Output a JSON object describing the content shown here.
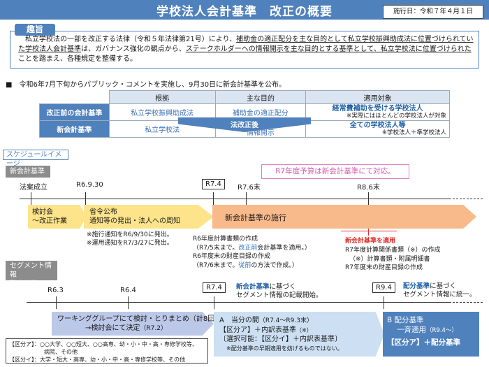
{
  "header": {
    "title": "学校法人会計基準　改正の概要",
    "effective_date": "施行日：令和７年４月１日"
  },
  "summary": {
    "label": "趣旨",
    "text_1": "　私立学校法の一部を改正する法律（令和５年法律第21号）により、",
    "text_2": "補助金の適正配分を主な目的として私立学校振興助成法に位置づけられていた学校法人会計基準",
    "text_3": "は、ガバナンス強化の観点から、",
    "text_4": "ステークホルダーへの情報開示を主な目的とする基準として、私立学校法に位置づけられた",
    "text_5": "ことを踏まえ、各種規定を整備する。"
  },
  "announcement": "■　令和6年7月下旬からパブリック・コメントを実施し、9月30日に新会計基準を公布。",
  "comparison_table": {
    "headers": [
      "根拠",
      "主な目的",
      "適用対象"
    ],
    "rows": [
      {
        "label": "改正前の会計基準",
        "basis": "私立学校振興助成法",
        "purpose": "補助金の適正配分",
        "target": "経常費補助を受ける学校法人",
        "target_note": "※実際にはほとんどの学校法人が対象"
      },
      {
        "label": "新会計基準",
        "basis": "私立学校法",
        "purpose": "情報開示",
        "target": "全ての学校法人等",
        "target_note": "※学校法人＋準学校法人"
      }
    ],
    "arrow_label": "法改正後"
  },
  "schedule": {
    "tag": "スケジュールイメージ",
    "new_standard": {
      "label": "新会計基準",
      "budget_note": "R7年度予算は新会計基準にて対応。",
      "points": {
        "bill": "法案成立",
        "r6_9_30": "R6.9.30",
        "r7_4": "R7.4",
        "r7_6": "R7.6末",
        "r8_6": "R8.6末"
      },
      "review_1": "検討会",
      "review_2": "～改正作業",
      "ordinance_1": "省令公布",
      "ordinance_2": "通知等の発出・法人への周知",
      "notice_1": "※施行通知をR6/9/30に発出。",
      "notice_2": "※運用通知をR7/3/27に発出。",
      "enforcement": "新会計基準の施行",
      "r6_docs_1": "R6年度計算書類の作成",
      "r6_docs_2a": "（R7/5末まで。",
      "r6_docs_2b": "改正前",
      "r6_docs_2c": "会計基準を適用。）",
      "r6_docs_3": "R6年度末の財産目録の作成",
      "r6_docs_4a": "（R7/6末まで。",
      "r6_docs_4b": "従前",
      "r6_docs_4c": "の方法で作成。）",
      "apply_label": "新会計基準を適用",
      "r7_docs_1": "R7年度計算関係書類（※）の作成",
      "r7_docs_2": "（※）計算書類・附属明細書",
      "r7_docs_3": "R7年度末の財産目録の作成"
    },
    "segment": {
      "label_1": "セグメント情報",
      "label_2": "配分基準",
      "points": {
        "r6_3": "R6.3",
        "r6_4": "R6.4",
        "r7_4": "R7.4",
        "r9_4": "R9.4"
      },
      "r7_note_1a": "新会計基準",
      "r7_note_1b": "に基づく",
      "r7_note_2": "セグメント情報の記載開始。",
      "r9_note_1a": "配分基準",
      "r9_note_1b": "に基づく",
      "r9_note_2": "セグメント情報に統一。",
      "wg_1": "ワーキンググループにて検討・とりまとめ（計8回）",
      "wg_2a": "→検討会にて決定",
      "wg_2b": "（R7.2）",
      "period_a_1": "A　当分の間",
      "period_a_1b": "（R7.4～R9.3末）",
      "period_a_2": "【区分ア】＋内訳表基準",
      "period_a_2b": "（※）",
      "period_a_3": "〔選択可能：【区分イ】＋内訳表基準〕",
      "period_a_4": "※配分基準の早期適用を妨げるものではない。",
      "period_b_1": "B 配分基準",
      "period_b_2": "一斉適用",
      "period_b_2b": "（R9.4～）",
      "period_b_3": "【区分ア】＋配分基準",
      "cat_a_1": "【区分ア】：○○大学、○○短大、○○高専、幼・小・中・高・専修学校等、",
      "cat_a_2": "病院、その他",
      "cat_i": "【区分イ】：大学・短大・高専、幼・小・中・高・専修学校等、その他"
    }
  }
}
